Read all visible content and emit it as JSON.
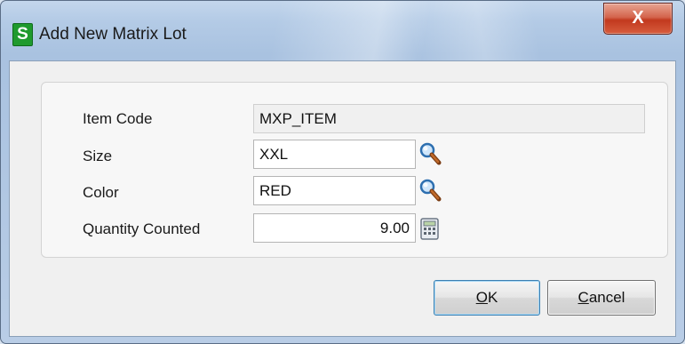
{
  "window": {
    "title": "Add New Matrix Lot",
    "app_icon_letter": "S",
    "close_glyph": "X"
  },
  "form": {
    "item_code": {
      "label": "Item Code",
      "value": "MXP_ITEM"
    },
    "size": {
      "label": "Size",
      "value": "XXL",
      "lookup_icon": "magnifier-icon"
    },
    "color": {
      "label": "Color",
      "value": "RED",
      "lookup_icon": "magnifier-icon"
    },
    "quantity_counted": {
      "label": "Quantity Counted",
      "value": "9.00",
      "calculator_icon": "calculator-icon"
    }
  },
  "buttons": {
    "ok": {
      "accel": "O",
      "rest": "K"
    },
    "cancel": {
      "accel": "C",
      "rest": "ancel"
    }
  }
}
